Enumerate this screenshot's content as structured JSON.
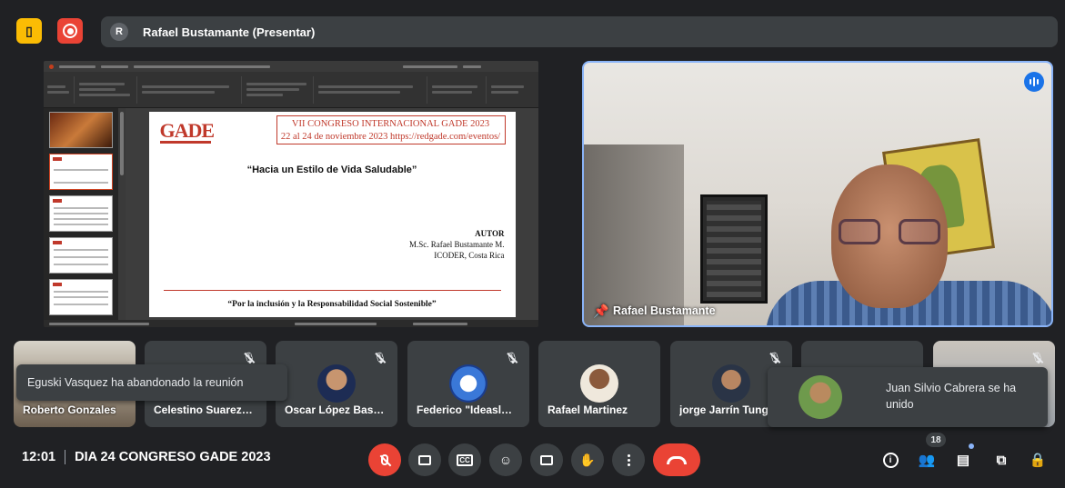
{
  "top": {
    "presenter_initial": "R",
    "presenter_label": "Rafael Bustamante (Presentar)",
    "icons": [
      "door-icon",
      "record-icon"
    ]
  },
  "slide": {
    "logo": "GADE",
    "congress_line1": "VII CONGRESO INTERNACIONAL GADE 2023",
    "congress_line2": "22 al 24 de noviembre 2023 https://redgade.com/eventos/",
    "title": "“Hacia un Estilo de Vida Saludable”",
    "author_label": "AUTOR",
    "author_name": "M.Sc. Rafael Bustamante M.",
    "author_org": "ICODER, Costa Rica",
    "footer": "“Por la inclusión y la Responsabilidad Social Sostenible”"
  },
  "camera": {
    "name": "Rafael Bustamante"
  },
  "participants": [
    {
      "name": "Roberto Gonzales"
    },
    {
      "name": "Celestino Suarez…"
    },
    {
      "name": "Oscar López Bas…"
    },
    {
      "name": "Federico \"Ideasl…"
    },
    {
      "name": "Rafael Martinez"
    },
    {
      "name": "jorge Jarrín Tung"
    }
  ],
  "toasts": {
    "left": "Eguski Vasquez ha abandonado la reunión",
    "right": "Juan Silvio Cabrera se ha unido"
  },
  "bottom": {
    "time": "12:01",
    "meeting_title": "DIA 24 CONGRESO GADE 2023",
    "people_count": "18"
  },
  "colors": {
    "background": "#202124",
    "tile": "#3c4043",
    "accent_blue": "#8ab4f8",
    "danger_red": "#ea4335",
    "door_yellow": "#fbbc04"
  }
}
